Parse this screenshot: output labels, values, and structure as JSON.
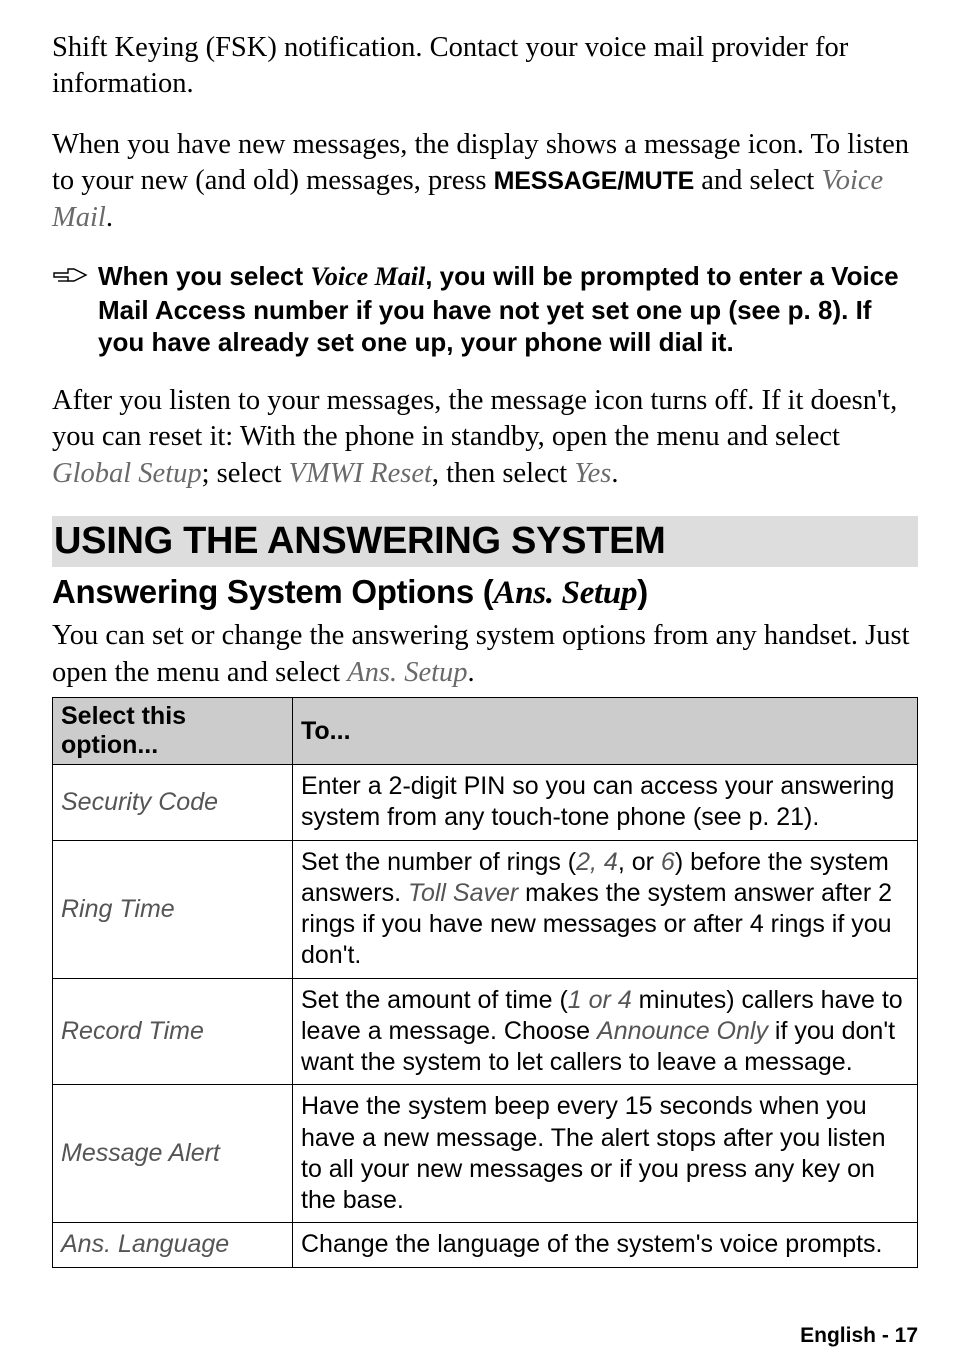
{
  "para1_a": "Shift Keying (FSK) notification. Contact your voice mail provider for information.",
  "para2_a": "When you have new messages, the display shows a message icon. To listen to your new (and old) messages, press ",
  "para2_key": "MESSAGE/MUTE",
  "para2_b": " and select ",
  "para2_menu": "Voice Mail",
  "para2_c": ".",
  "callout_a": "When you select ",
  "callout_menu": "Voice Mail",
  "callout_b": ", you will be prompted to enter a Voice Mail Access number if you have not yet set one up (see p. 8). If you have already set one up, your phone will dial it.",
  "para3_a": "After you listen to your messages, the message icon turns off. If it doesn't, you can reset it: With the phone in standby, open the menu and select ",
  "para3_menu1": "Global Setup",
  "para3_b": "; select ",
  "para3_menu2": "VMWI Reset",
  "para3_c": ", then select ",
  "para3_menu3": "Yes",
  "para3_d": ".",
  "h1": "USING THE ANSWERING SYSTEM",
  "h2_a": "Answering System Options (",
  "h2_italic": "Ans. Setup",
  "h2_b": ")",
  "intro_a": "You can set or change the answering system options from any handset. Just open the menu and select ",
  "intro_menu": "Ans. Setup",
  "intro_b": ".",
  "table": {
    "header1": "Select this option...",
    "header2": "To...",
    "rows": [
      {
        "name": "Security Code",
        "desc_a": "Enter a 2-digit PIN so you can access your answering system from any touch-tone phone (see p. 21)."
      },
      {
        "name": "Ring Time",
        "desc_a": "Set the number of rings (",
        "italic1": "2, 4",
        "desc_b": ", or ",
        "italic2": "6",
        "desc_c": ") before the system answers. ",
        "italic3": "Toll Saver",
        "desc_d": " makes the system answer after 2 rings if you have new messages or after 4 rings if you don't."
      },
      {
        "name": "Record Time",
        "desc_a": "Set the amount of time (",
        "italic1": "1 or 4",
        "desc_b": " minutes) callers have to leave a message. Choose ",
        "italic2": "Announce Only",
        "desc_c": " if you don't want the system to let callers to leave a message."
      },
      {
        "name": "Message Alert",
        "desc_a": "Have the system beep every 15 seconds when you have a new message. The alert stops after you listen to all your new messages or if you press any key on the base."
      },
      {
        "name": "Ans. Language",
        "desc_a": "Change the language of the system's voice prompts."
      }
    ]
  },
  "footer": "English - 17"
}
